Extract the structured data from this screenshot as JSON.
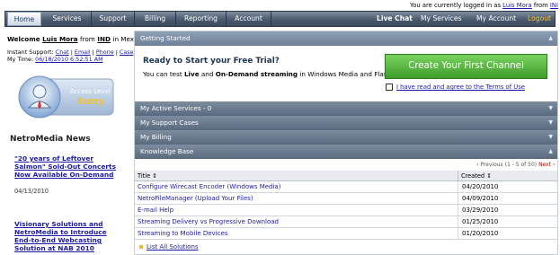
{
  "topbar": {
    "prefix": "You are currently logged in as",
    "user": "Luis Mora",
    "from": "from",
    "company": "INI"
  },
  "nav": {
    "tabs": [
      {
        "label": "Home"
      },
      {
        "label": "Services"
      },
      {
        "label": "Support"
      },
      {
        "label": "Billing"
      },
      {
        "label": "Reporting"
      },
      {
        "label": "Account"
      }
    ],
    "right": {
      "live_chat": "Live Chat",
      "my_services": "My Services",
      "my_account": "My Account",
      "logout": "Logout"
    }
  },
  "sidebar": {
    "welcome": "Welcome",
    "user": "Luis Mora",
    "from": "from",
    "company": "IND",
    "location": "in Mexico",
    "support_label": "Instant Support:",
    "support_links": [
      "Chat",
      "Email",
      "Phone",
      "Case"
    ],
    "time_label": "My Time:",
    "time_value": "06/18/2010 6:52:51 AM",
    "badge": {
      "line1": "Access Level",
      "line2": "Entry"
    },
    "news_title": "NetroMedia News",
    "news": [
      {
        "headline": "\"20 years of Leftover Salmon\" Sold-Out Concerts Now Available On-Demand",
        "date": "04/13/2010"
      },
      {
        "headline": "Visionary Solutions and NetroMedia to Introduce End-to-End Webcasting Solution at NAB 2010",
        "date": ""
      }
    ]
  },
  "main": {
    "getting_started": "Getting Started",
    "trial_title": "Ready to Start your Free Trial?",
    "trial_text_1": "You can test",
    "trial_live": "Live",
    "trial_and": "and",
    "trial_ondemand": "On-Demand streaming",
    "trial_text_2": "in Windows Media and Flash.",
    "cta": "Create Your First Channel",
    "terms": "I have read and agree to the Terms of Use",
    "sections": [
      "My Active Services - 0",
      "My Support Cases",
      "My Billing",
      "Knowledge Base"
    ],
    "pager": {
      "prev": "Previous",
      "info": "(1 - 5 of 50)",
      "next": "Next"
    },
    "table": {
      "col_title": "Title",
      "col_created": "Created",
      "rows": [
        {
          "title": "Configure Wirecast Encoder (Windows Media)",
          "date": "04/20/2010"
        },
        {
          "title": "NetroFileManager (Upload Your Files)",
          "date": "04/09/2010"
        },
        {
          "title": "E-mail Help",
          "date": "03/29/2010"
        },
        {
          "title": "Streaming Delivery vs Progressive Download",
          "date": "01/25/2010"
        },
        {
          "title": "Streaming to Mobile Devices",
          "date": "01/20/2010"
        }
      ]
    },
    "list_all": "List All Solutions"
  }
}
